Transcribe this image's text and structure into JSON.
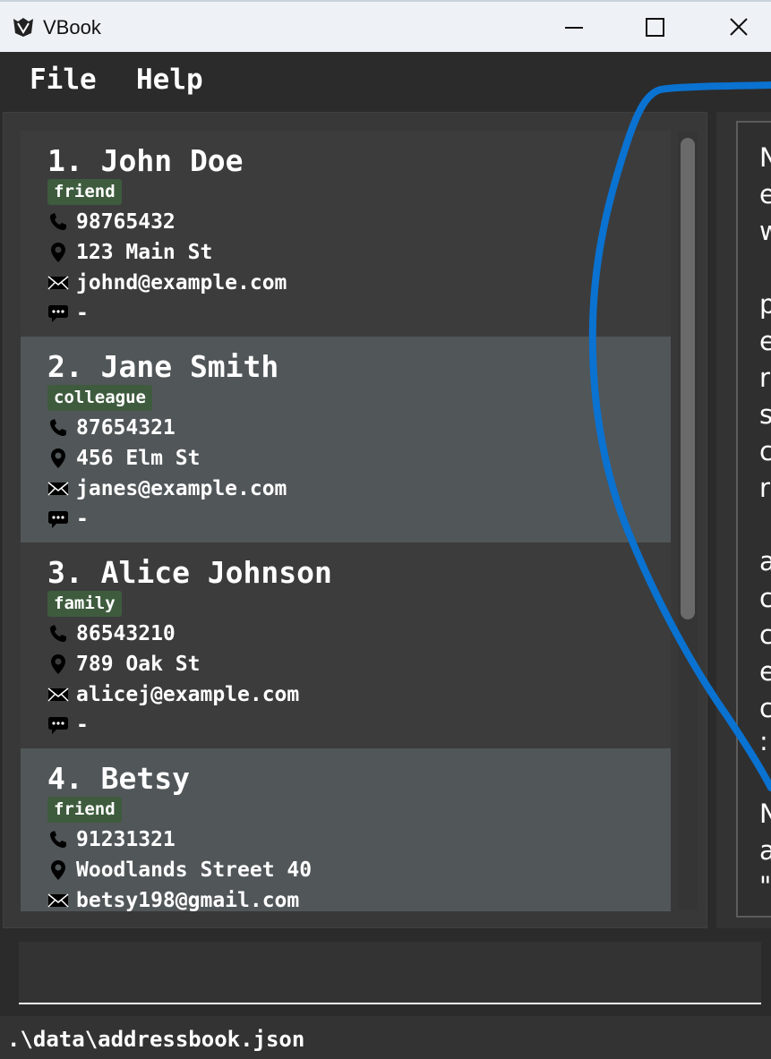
{
  "window": {
    "title": "VBook",
    "icon": "vbook-logo-icon"
  },
  "menu": {
    "file": "File",
    "help": "Help"
  },
  "persons": [
    {
      "index_name": "1. John Doe",
      "tag": "friend",
      "phone": "98765432",
      "address": "123 Main St",
      "email": "johnd@example.com",
      "remark": "-"
    },
    {
      "index_name": "2. Jane Smith",
      "tag": "colleague",
      "phone": "87654321",
      "address": "456 Elm St",
      "email": "janes@example.com",
      "remark": "-"
    },
    {
      "index_name": "3. Alice Johnson",
      "tag": "family",
      "phone": "86543210",
      "address": "789 Oak St",
      "email": "alicej@example.com",
      "remark": "-"
    },
    {
      "index_name": "4. Betsy",
      "tag": "friend",
      "phone": "91231321",
      "address": "Woodlands Street 40",
      "email": "betsy198@gmail.com",
      "remark": ""
    }
  ],
  "result_panel": {
    "lines": [
      "N",
      "e",
      "w",
      "",
      "p",
      "e",
      "r",
      "s",
      "c",
      "r",
      "",
      "a",
      "c",
      "c",
      "e",
      "c",
      ":",
      "",
      "N",
      "a",
      "\""
    ]
  },
  "command_box": {
    "value": "",
    "placeholder": ""
  },
  "status": {
    "path": ".\\data\\addressbook.json"
  },
  "colors": {
    "tag_bg": "#3e5b3e",
    "card_odd": "#3c3c3c",
    "card_even": "#515658",
    "annotation_stroke": "#0a72d1"
  }
}
